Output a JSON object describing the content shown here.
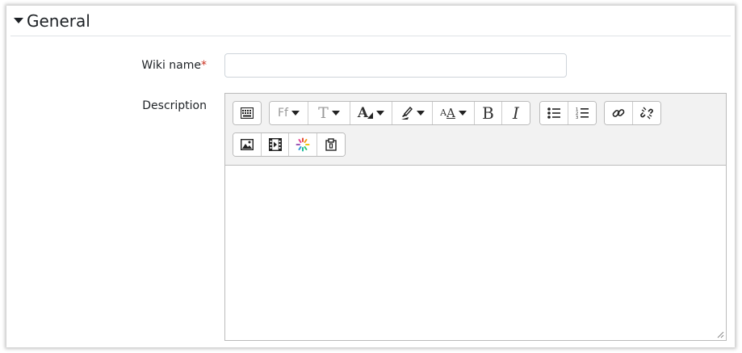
{
  "section": {
    "title": "General",
    "caret_icon": "caret-down-icon"
  },
  "wiki_name": {
    "label": "Wiki name",
    "required_marker": "*",
    "value": "",
    "placeholder": ""
  },
  "description": {
    "label": "Description",
    "content": ""
  },
  "toolbar": {
    "row1": [
      {
        "name": "show-more-buttons-icon"
      },
      {
        "name": "font-family-icon",
        "text": "Ff"
      },
      {
        "name": "font-size-icon",
        "text": "T"
      },
      {
        "name": "font-color-icon",
        "text": "A"
      },
      {
        "name": "background-color-icon"
      },
      {
        "name": "paragraph-styles-icon",
        "text": "A"
      },
      {
        "name": "bold-icon",
        "text": "B"
      },
      {
        "name": "italic-icon",
        "text": "I"
      },
      {
        "name": "unordered-list-icon"
      },
      {
        "name": "ordered-list-icon"
      },
      {
        "name": "link-icon"
      },
      {
        "name": "unlink-icon"
      }
    ],
    "row2": [
      {
        "name": "insert-image-icon"
      },
      {
        "name": "insert-media-icon"
      },
      {
        "name": "h5p-icon"
      },
      {
        "name": "manage-files-icon"
      }
    ]
  },
  "colors": {
    "text": "#1d2125",
    "required": "#ca3120",
    "border": "#bbbbbb",
    "toolbar_bg": "#f2f2f2"
  }
}
